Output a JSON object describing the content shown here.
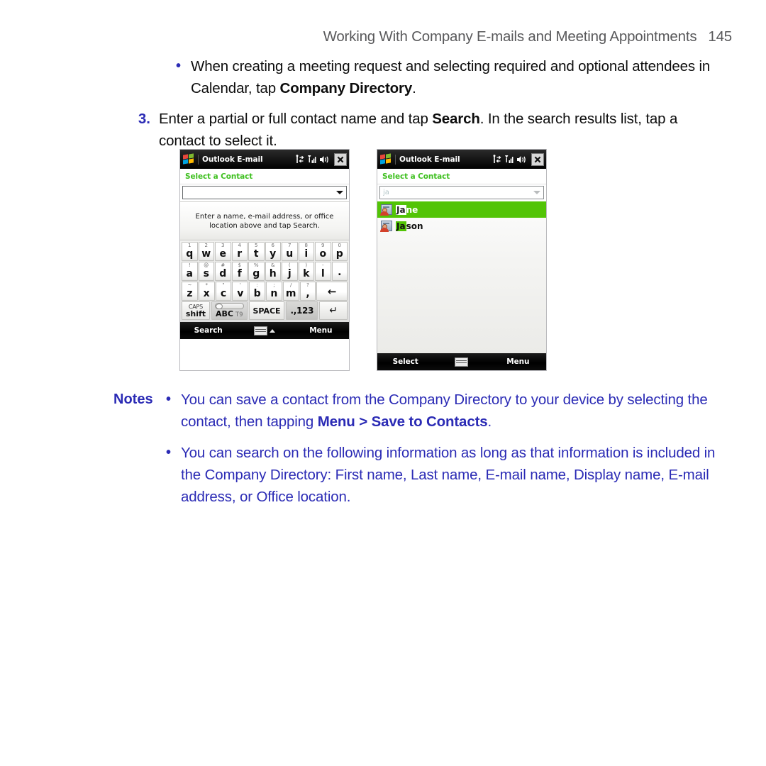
{
  "header": {
    "title": "Working With Company E-mails and Meeting Appointments",
    "page_number": "145"
  },
  "content": {
    "bullet_1": {
      "marker": "•",
      "text_before": "When creating a meeting request and selecting required and optional attendees in Calendar, tap ",
      "bold": "Company Directory",
      "text_after": "."
    },
    "step_3": {
      "marker": "3.",
      "part_1": "Enter a partial or full contact name and tap ",
      "bold_1": "Search",
      "part_2": ". In the search results list, tap a contact to select it."
    }
  },
  "screens": [
    {
      "titlebar": {
        "title": "Outlook E-mail",
        "icons": [
          "connectivity-icon",
          "signal-icon",
          "volume-icon"
        ],
        "close_label": "✕"
      },
      "section_header": "Select a Contact",
      "search_field": {
        "value": "",
        "placeholder": ""
      },
      "hint": "Enter a name, e-mail address, or office location above and tap Search.",
      "keyboard": {
        "row1": [
          {
            "sup": "1",
            "main": "q"
          },
          {
            "sup": "2",
            "main": "w"
          },
          {
            "sup": "3",
            "main": "e"
          },
          {
            "sup": "4",
            "main": "r"
          },
          {
            "sup": "5",
            "main": "t"
          },
          {
            "sup": "6",
            "main": "y"
          },
          {
            "sup": "7",
            "main": "u"
          },
          {
            "sup": "8",
            "main": "i"
          },
          {
            "sup": "9",
            "main": "o"
          },
          {
            "sup": "0",
            "main": "p"
          }
        ],
        "row2": [
          {
            "sup": "!",
            "main": "a"
          },
          {
            "sup": "@",
            "main": "s"
          },
          {
            "sup": "#",
            "main": "d"
          },
          {
            "sup": "$",
            "main": "f"
          },
          {
            "sup": "%",
            "main": "g"
          },
          {
            "sup": "&",
            "main": "h"
          },
          {
            "sup": "(",
            "main": "j"
          },
          {
            "sup": ")",
            "main": "k"
          },
          {
            "sup": "-",
            "main": "l"
          },
          {
            "sup": "",
            "main": "."
          }
        ],
        "row3": [
          {
            "sup": "~",
            "main": "z"
          },
          {
            "sup": "*",
            "main": "x"
          },
          {
            "sup": "\"",
            "main": "c"
          },
          {
            "sup": "'",
            "main": "v"
          },
          {
            "sup": ":",
            "main": "b"
          },
          {
            "sup": ";",
            "main": "n"
          },
          {
            "sup": "/",
            "main": "m"
          },
          {
            "sup": "?",
            "main": ","
          }
        ],
        "backspace": "←",
        "caps_line1": "CAPS",
        "caps_line2": "shift",
        "t9_on": "ABC",
        "t9_off": "T9",
        "space": "SPACE",
        "sym": ".,123",
        "enter": "↵"
      },
      "softkeys": {
        "left": "Search",
        "middle_icon": "keyboard-icon",
        "right": "Menu"
      }
    },
    {
      "titlebar": {
        "title": "Outlook E-mail",
        "icons": [
          "connectivity-icon",
          "signal-icon",
          "volume-icon"
        ],
        "close_label": "✕"
      },
      "section_header": "Select a Contact",
      "search_field": {
        "value": "ja",
        "placeholder": "ja"
      },
      "results": [
        {
          "match": "Ja",
          "rest": "ne",
          "selected": true
        },
        {
          "match": "Ja",
          "rest": "son",
          "selected": false
        }
      ],
      "softkeys": {
        "left": "Select",
        "middle_icon": "keyboard-icon",
        "right": "Menu"
      }
    }
  ],
  "notes": {
    "label": "Notes",
    "items": [
      {
        "marker": "•",
        "part_1": "You can save a contact from the Company Directory to your device by selecting the contact, then tapping ",
        "bold_1": "Menu > Save to Contacts",
        "part_2": "."
      },
      {
        "marker": "•",
        "part_1": "You can search on the following information as long as that information is included in the Company Directory: First name, Last name, E-mail name, Display name, E-mail address, or Office location.",
        "bold_1": "",
        "part_2": ""
      }
    ]
  },
  "colors": {
    "heading_gray": "#59595b",
    "accent_blue": "#2b2bb5",
    "screen_green": "#3fc020",
    "selection_green": "#52c406",
    "body_black": "#0d0d0d"
  }
}
